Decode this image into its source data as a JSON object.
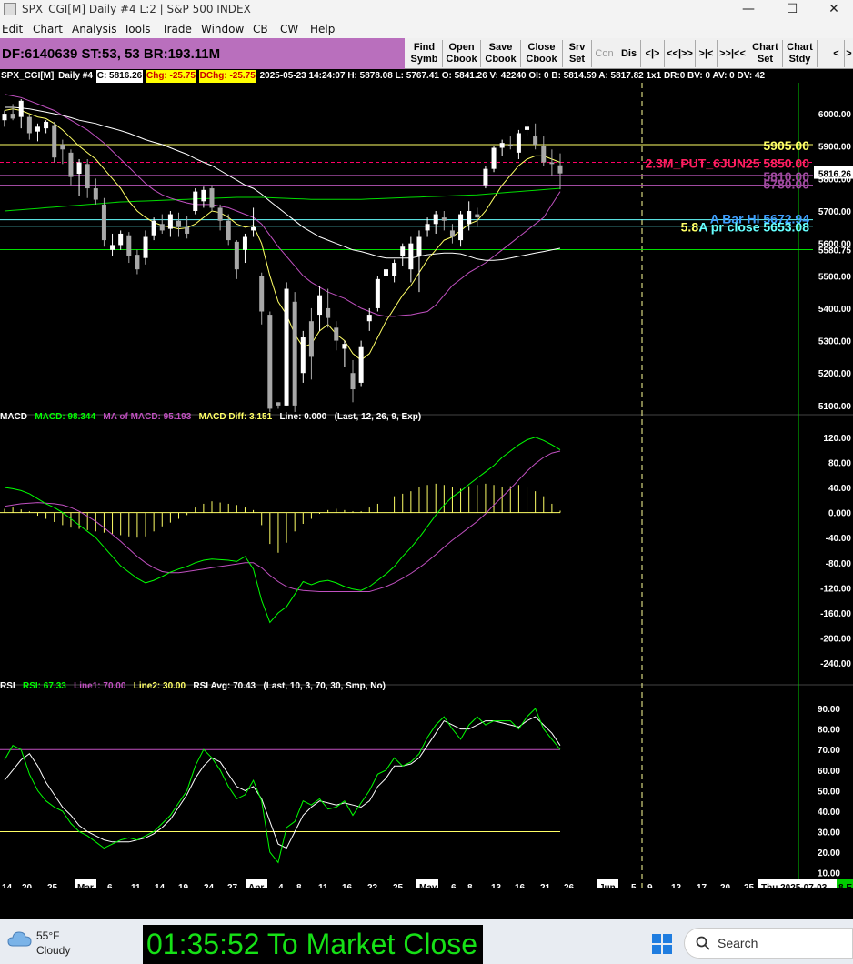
{
  "window": {
    "title": "SPX_CGI[M]  Daily #4 L:2 | S&P 500 INDEX",
    "minimize": "—",
    "maximize": "☐",
    "close": "✕"
  },
  "menu": [
    "Edit",
    "Chart",
    "Analysis",
    "Tools",
    "Trade",
    "Window",
    "CB",
    "CW",
    "Help"
  ],
  "toolbar": {
    "df_info": "DF:6140639  ST:53, 53  BR:193.11M",
    "buttons": [
      {
        "line1": "Find",
        "line2": "Symb"
      },
      {
        "line1": "Open",
        "line2": "Cbook"
      },
      {
        "line1": "Save",
        "line2": "Cbook"
      },
      {
        "line1": "Close",
        "line2": "Cbook"
      },
      {
        "line1": "Srv",
        "line2": "Set"
      },
      {
        "line1": "Con",
        "line2": ""
      },
      {
        "line1": "Dis",
        "line2": ""
      },
      {
        "line1": "<|>",
        "line2": ""
      },
      {
        "line1": "<<|>>",
        "line2": ""
      },
      {
        "line1": ">|<",
        "line2": ""
      },
      {
        "line1": ">>|<<",
        "line2": ""
      },
      {
        "line1": "Chart",
        "line2": "Set"
      },
      {
        "line1": "Chart",
        "line2": "Stdy"
      },
      {
        "line1": "<",
        "line2": ""
      },
      {
        "line1": ">",
        "line2": ""
      }
    ]
  },
  "info": {
    "symbol": "SPX_CGI[M]",
    "interval": "Daily #4",
    "close": "C: 5816.26",
    "chg": "Chg: -25.75",
    "dchg": "DChg: -25.75",
    "rest": "2025-05-23 14:24:07 H: 5878.08  L: 5767.41  O: 5841.26  V: 42240  OI: 0  B: 5814.59  A: 5817.82 1x1  DR:0  BV: 0  AV: 0  DV: 42"
  },
  "price_labels": {
    "level_5905": "5905.00",
    "put_label": "2.3M_PUT_6JUN25  5850.00",
    "level_5810": "5810.00",
    "level_5780": "5780.00",
    "current_price": "5816.26",
    "a_bar_hi": "A Bar Hi  5672.94",
    "prefix_58": "5.8.",
    "a_pr_close": "A pr close  5653.08",
    "level_5580": "5580.75"
  },
  "colors": {
    "accent_magenta": "#b96fbd",
    "up_candle": "#ffffff",
    "down_candle": "#a8a8a8",
    "ma_fast": "#ffff66",
    "ma_mid": "#ffffff",
    "ma_slow": "#c050c0",
    "ma_long": "#00dd00",
    "hline_yellow": "#ffff66",
    "hline_put": "#ff0066",
    "hline_cyan": "#66ffff",
    "macd_line": "#00ff00",
    "macd_ma": "#c050c0",
    "macd_hist": "#ffff66",
    "rsi_line": "#00ff00",
    "rsi_avg": "#ffffff"
  },
  "macd_panel": {
    "label": "MACD",
    "macd": "MACD: 98.344",
    "ma": "MA of MACD: 95.193",
    "diff": "MACD Diff: 3.151",
    "line": "Line: 0.000",
    "params": "(Last, 12, 26, 9, Exp)"
  },
  "rsi_panel": {
    "label": "RSI",
    "rsi": "RSI: 67.33",
    "line1": "Line1: 70.00",
    "line2": "Line2: 30.00",
    "avg": "RSI Avg: 70.43",
    "params": "(Last, 10, 3, 70, 30, Smp, No)"
  },
  "chart_data": {
    "type": "candlestick",
    "price_ticks": [
      6000,
      5900,
      5800,
      5700,
      5600,
      5500,
      5400,
      5300,
      5200,
      5100
    ],
    "price_tick_labels": [
      "6000.00",
      "5900.00",
      "5800.00",
      "5700.00",
      "5600.00",
      "5500.00",
      "5400.00",
      "5300.00",
      "5200.00",
      "5100.00"
    ],
    "price_range": [
      5080,
      6090
    ],
    "macd_ticks": [
      120,
      80,
      40,
      0,
      -40,
      -80,
      -120,
      -160,
      -200,
      -240
    ],
    "macd_tick_labels": [
      "120.00",
      "80.00",
      "40.00",
      "0.000",
      "-40.00",
      "-80.00",
      "-120.00",
      "-160.00",
      "-200.00",
      "-240.00"
    ],
    "macd_range": [
      -260,
      140
    ],
    "rsi_ticks": [
      90,
      80,
      70,
      60,
      50,
      40,
      30,
      20,
      10
    ],
    "rsi_tick_labels": [
      "90.00",
      "80.00",
      "70.00",
      "60.00",
      "50.00",
      "40.00",
      "30.00",
      "20.00",
      "10.00"
    ],
    "rsi_range": [
      5,
      98
    ],
    "horizontal_levels": [
      5905,
      5850,
      5810,
      5780,
      5672.94,
      5653.08,
      5580.75
    ],
    "date_labels": [
      "14",
      "20",
      "25",
      "Mar",
      "6",
      "11",
      "14",
      "19",
      "24",
      "27",
      "Apr",
      "4",
      "8",
      "11",
      "16",
      "22",
      "25",
      "May",
      "6",
      "8",
      "13",
      "16",
      "21",
      "26",
      "Jun",
      "5",
      "9",
      "12",
      "17",
      "20",
      "25",
      "Thu 2025-07-03",
      "8 E"
    ],
    "candles": [
      [
        5980,
        6010,
        5960,
        6000
      ],
      [
        6000,
        6030,
        5980,
        5985
      ],
      [
        5990,
        6045,
        5955,
        6040
      ],
      [
        5990,
        5995,
        5920,
        5940
      ],
      [
        5945,
        5970,
        5915,
        5960
      ],
      [
        5955,
        5980,
        5940,
        5975
      ],
      [
        5965,
        5975,
        5850,
        5865
      ],
      [
        5905,
        5920,
        5845,
        5890
      ],
      [
        5880,
        5890,
        5780,
        5805
      ],
      [
        5815,
        5860,
        5745,
        5850
      ],
      [
        5845,
        5860,
        5740,
        5770
      ],
      [
        5770,
        5800,
        5720,
        5735
      ],
      [
        5720,
        5740,
        5590,
        5610
      ],
      [
        5580,
        5630,
        5560,
        5595
      ],
      [
        5595,
        5640,
        5580,
        5630
      ],
      [
        5625,
        5635,
        5540,
        5560
      ],
      [
        5565,
        5580,
        5505,
        5520
      ],
      [
        5555,
        5640,
        5535,
        5620
      ],
      [
        5625,
        5680,
        5610,
        5670
      ],
      [
        5660,
        5690,
        5630,
        5640
      ],
      [
        5645,
        5700,
        5620,
        5690
      ],
      [
        5670,
        5695,
        5620,
        5650
      ],
      [
        5650,
        5685,
        5615,
        5630
      ],
      [
        5700,
        5770,
        5690,
        5760
      ],
      [
        5730,
        5775,
        5710,
        5765
      ],
      [
        5770,
        5780,
        5700,
        5710
      ],
      [
        5710,
        5720,
        5640,
        5670
      ],
      [
        5670,
        5690,
        5595,
        5610
      ],
      [
        5605,
        5610,
        5490,
        5520
      ],
      [
        5580,
        5630,
        5540,
        5620
      ],
      [
        5640,
        5710,
        5620,
        5650
      ],
      [
        5500,
        5510,
        5350,
        5390
      ],
      [
        5380,
        5390,
        5080,
        5090
      ],
      [
        5110,
        5110,
        5090,
        5100
      ],
      [
        5100,
        5480,
        5100,
        5460
      ],
      [
        5420,
        5450,
        5080,
        5100
      ],
      [
        5200,
        5330,
        5170,
        5310
      ],
      [
        5360,
        5400,
        5180,
        5250
      ],
      [
        5380,
        5470,
        5330,
        5440
      ],
      [
        5400,
        5460,
        5340,
        5370
      ],
      [
        5340,
        5360,
        5270,
        5300
      ],
      [
        5275,
        5300,
        5220,
        5290
      ],
      [
        5200,
        5240,
        5110,
        5150
      ],
      [
        5170,
        5300,
        5160,
        5280
      ],
      [
        5360,
        5400,
        5330,
        5380
      ],
      [
        5400,
        5500,
        5390,
        5490
      ],
      [
        5500,
        5530,
        5450,
        5520
      ],
      [
        5500,
        5550,
        5480,
        5540
      ],
      [
        5560,
        5600,
        5530,
        5590
      ],
      [
        5520,
        5620,
        5480,
        5600
      ],
      [
        5560,
        5640,
        5450,
        5620
      ],
      [
        5640,
        5680,
        5620,
        5660
      ],
      [
        5660,
        5700,
        5630,
        5690
      ],
      [
        5680,
        5700,
        5640,
        5670
      ],
      [
        5640,
        5660,
        5600,
        5620
      ],
      [
        5610,
        5700,
        5590,
        5690
      ],
      [
        5660,
        5730,
        5640,
        5700
      ],
      [
        5690,
        5710,
        5650,
        5680
      ],
      [
        5780,
        5840,
        5770,
        5830
      ],
      [
        5830,
        5900,
        5820,
        5895
      ],
      [
        5895,
        5920,
        5870,
        5910
      ],
      [
        5905,
        5930,
        5890,
        5900
      ],
      [
        5880,
        5950,
        5860,
        5940
      ],
      [
        5950,
        5980,
        5930,
        5960
      ],
      [
        5930,
        5970,
        5890,
        5905
      ],
      [
        5900,
        5930,
        5840,
        5850
      ],
      [
        5850,
        5890,
        5810,
        5845
      ],
      [
        5841,
        5878,
        5767,
        5816
      ]
    ],
    "ma_fast": [
      6010,
      6015,
      6010,
      6000,
      5990,
      5985,
      5970,
      5950,
      5925,
      5900,
      5880,
      5860,
      5830,
      5800,
      5770,
      5730,
      5700,
      5680,
      5665,
      5655,
      5650,
      5645,
      5648,
      5660,
      5680,
      5700,
      5695,
      5680,
      5660,
      5650,
      5655,
      5600,
      5500,
      5420,
      5380,
      5320,
      5280,
      5290,
      5330,
      5350,
      5320,
      5300,
      5260,
      5240,
      5260,
      5310,
      5360,
      5400,
      5440,
      5470,
      5510,
      5550,
      5580,
      5610,
      5620,
      5640,
      5660,
      5670,
      5700,
      5740,
      5780,
      5810,
      5840,
      5860,
      5870,
      5870,
      5860,
      5850
    ],
    "ma_mid": [
      6020,
      6020,
      6018,
      6015,
      6010,
      6005,
      6000,
      5995,
      5988,
      5980,
      5975,
      5970,
      5962,
      5955,
      5948,
      5940,
      5930,
      5920,
      5912,
      5905,
      5895,
      5885,
      5875,
      5862,
      5850,
      5840,
      5825,
      5810,
      5795,
      5780,
      5770,
      5752,
      5730,
      5710,
      5690,
      5670,
      5650,
      5635,
      5620,
      5610,
      5600,
      5590,
      5580,
      5575,
      5568,
      5560,
      5555,
      5555,
      5555,
      5555,
      5560,
      5565,
      5568,
      5570,
      5570,
      5568,
      5560,
      5552,
      5548,
      5548,
      5550,
      5555,
      5560,
      5565,
      5570,
      5575,
      5580,
      5585
    ],
    "ma_slow": [
      6060,
      6055,
      6050,
      6040,
      6030,
      6020,
      6010,
      5995,
      5980,
      5965,
      5950,
      5930,
      5910,
      5885,
      5860,
      5835,
      5810,
      5785,
      5765,
      5750,
      5740,
      5732,
      5725,
      5720,
      5720,
      5720,
      5715,
      5710,
      5700,
      5690,
      5680,
      5660,
      5625,
      5590,
      5560,
      5530,
      5500,
      5480,
      5465,
      5450,
      5440,
      5430,
      5415,
      5400,
      5390,
      5380,
      5375,
      5375,
      5378,
      5380,
      5385,
      5390,
      5410,
      5440,
      5470,
      5490,
      5510,
      5525,
      5540,
      5560,
      5580,
      5600,
      5620,
      5640,
      5660,
      5680,
      5720,
      5760
    ],
    "ma_long": [
      5700,
      5702,
      5704,
      5706,
      5708,
      5710,
      5712,
      5714,
      5716,
      5718,
      5720,
      5722,
      5724,
      5726,
      5728,
      5729,
      5730,
      5731,
      5732,
      5733,
      5734,
      5735,
      5736,
      5737,
      5738,
      5739,
      5740,
      5741,
      5742,
      5742,
      5742,
      5742,
      5741,
      5740,
      5739,
      5738,
      5737,
      5736,
      5736,
      5736,
      5736,
      5736,
      5736,
      5736,
      5737,
      5738,
      5739,
      5740,
      5741,
      5742,
      5743,
      5744,
      5745,
      5746,
      5747,
      5748,
      5749,
      5750,
      5752,
      5754,
      5756,
      5758,
      5760,
      5762,
      5764,
      5766,
      5768,
      5770
    ],
    "macd_line": [
      40,
      38,
      35,
      30,
      22,
      14,
      8,
      0,
      -10,
      -20,
      -30,
      -40,
      -55,
      -70,
      -85,
      -95,
      -105,
      -112,
      -108,
      -102,
      -95,
      -90,
      -86,
      -80,
      -76,
      -74,
      -75,
      -76,
      -78,
      -70,
      -90,
      -140,
      -175,
      -160,
      -150,
      -130,
      -110,
      -115,
      -110,
      -108,
      -112,
      -118,
      -122,
      -124,
      -118,
      -108,
      -98,
      -86,
      -70,
      -56,
      -40,
      -22,
      -4,
      12,
      25,
      34,
      45,
      55,
      65,
      75,
      88,
      98,
      108,
      116,
      120,
      115,
      108,
      100
    ],
    "macd_ma": [
      10,
      12,
      14,
      15,
      16,
      15,
      14,
      12,
      8,
      2,
      -6,
      -14,
      -24,
      -35,
      -46,
      -58,
      -70,
      -80,
      -88,
      -94,
      -96,
      -96,
      -94,
      -92,
      -90,
      -88,
      -86,
      -84,
      -82,
      -80,
      -80,
      -88,
      -100,
      -110,
      -118,
      -122,
      -124,
      -125,
      -126,
      -126,
      -126,
      -126,
      -126,
      -126,
      -126,
      -122,
      -118,
      -112,
      -105,
      -97,
      -88,
      -78,
      -67,
      -55,
      -44,
      -34,
      -24,
      -14,
      -2,
      12,
      25,
      38,
      52,
      66,
      78,
      88,
      95,
      98
    ],
    "macd_hist": [
      6,
      8,
      5,
      2,
      -5,
      -10,
      -15,
      -20,
      -24,
      -26,
      -28,
      -30,
      -32,
      -34,
      -36,
      -38,
      -40,
      -38,
      -30,
      -22,
      -16,
      -10,
      -4,
      8,
      14,
      18,
      16,
      14,
      12,
      8,
      4,
      -20,
      -50,
      -64,
      -48,
      -30,
      -18,
      -10,
      -2,
      4,
      6,
      4,
      2,
      2,
      8,
      14,
      20,
      26,
      30,
      34,
      40,
      44,
      46,
      44,
      40,
      38,
      42,
      44,
      46,
      44,
      40,
      42,
      44,
      40,
      34,
      26,
      14,
      3
    ],
    "rsi": [
      65,
      72,
      70,
      58,
      50,
      45,
      42,
      40,
      34,
      30,
      28,
      25,
      22,
      24,
      26,
      27,
      26,
      28,
      30,
      34,
      38,
      44,
      50,
      62,
      70,
      66,
      60,
      52,
      46,
      48,
      55,
      45,
      20,
      15,
      32,
      35,
      45,
      43,
      46,
      41,
      42,
      45,
      38,
      44,
      50,
      58,
      60,
      66,
      62,
      64,
      68,
      76,
      82,
      86,
      80,
      75,
      82,
      86,
      82,
      84,
      84,
      84,
      80,
      86,
      90,
      80,
      75,
      70
    ],
    "rsi_avg": [
      55,
      60,
      65,
      68,
      62,
      54,
      48,
      42,
      38,
      33,
      30,
      28,
      26,
      25,
      25,
      25,
      26,
      27,
      29,
      32,
      36,
      42,
      48,
      56,
      62,
      66,
      64,
      58,
      52,
      50,
      52,
      46,
      35,
      24,
      22,
      30,
      38,
      42,
      45,
      44,
      43,
      44,
      43,
      42,
      45,
      52,
      56,
      62,
      62,
      63,
      66,
      72,
      78,
      84,
      82,
      80,
      80,
      82,
      84,
      84,
      83,
      82,
      81,
      84,
      86,
      82,
      78,
      72
    ]
  },
  "taskbar": {
    "temperature": "55°F",
    "condition": "Cloudy",
    "countdown": "01:35:52 To Market Close",
    "search_label": "Search"
  }
}
